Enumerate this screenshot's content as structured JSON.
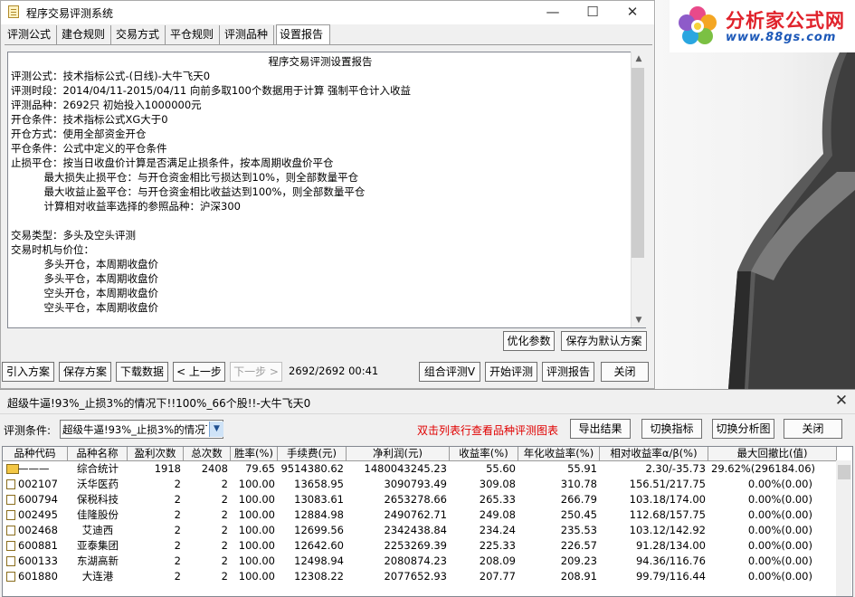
{
  "window": {
    "title": "程序交易评测系统",
    "minimize": "—",
    "maximize": "☐",
    "close": "✕"
  },
  "tabs": [
    "评测公式",
    "建仓规则",
    "交易方式",
    "平仓规则",
    "评测品种",
    "设置报告"
  ],
  "report": {
    "title": "程序交易评测设置报告",
    "lines": [
      "评测公式：技术指标公式-(日线)-大牛飞天0",
      "评测时段：2014/04/11-2015/04/11 向前多取100个数据用于计算 强制平仓计入收益",
      "评测品种：2692只 初始投入1000000元",
      "开仓条件：技术指标公式XG大于0",
      "开仓方式：使用全部资金开仓",
      "平仓条件：公式中定义的平仓条件",
      "止损平仓：按当日收盘价计算是否满足止损条件，按本周期收盘价平仓",
      "          最大损失止损平仓：与开仓资金相比亏损达到10%，则全部数量平仓",
      "          最大收益止盈平仓：与开仓资金相比收益达到100%，则全部数量平仓",
      "          计算相对收益率选择的参照品种：沪深300",
      "",
      "交易类型：多头及空头评测",
      "交易时机与价位：",
      "          多头开仓，本周期收盘价",
      "          多头平仓，本周期收盘价",
      "          空头开仓，本周期收盘价",
      "          空头平仓，本周期收盘价"
    ]
  },
  "buttons": {
    "optimize": "优化参数",
    "save_default": "保存为默认方案",
    "import_scheme": "引入方案",
    "save_scheme": "保存方案",
    "download_data": "下载数据",
    "prev_step": "< 上一步",
    "next_step": "下一步 >",
    "combo_eval": "组合评测V",
    "start_eval": "开始评测",
    "eval_report": "评测报告",
    "close": "关闭"
  },
  "progress": "2692/2692 00:41",
  "eval_window": {
    "title": "超级牛逼!93%_止损3%的情况下!!100%_66个股!!-大牛飞天0",
    "close": "✕",
    "criteria_label": "评测条件:",
    "criteria_value": "超级牛逼!93%_止损3%的情况下",
    "hint": "双击列表行查看品种评测图表",
    "buttons": {
      "export": "导出结果",
      "switch_indicator": "切换指标",
      "switch_chart": "切换分析图",
      "close": "关闭"
    }
  },
  "table": {
    "headers": [
      "品种代码",
      "品种名称",
      "盈利次数",
      "总次数",
      "胜率(%)",
      "手续费(元)",
      "净利润(元)",
      "收益率(%)",
      "年化收益率(%)",
      "相对收益率α/β(%)",
      "最大回撤比(值)"
    ],
    "rows": [
      [
        "———",
        "综合统计",
        "1918",
        "2408",
        "79.65",
        "9514380.62",
        "1480043245.23",
        "55.60",
        "55.91",
        "2.30/-35.73",
        "29.62%(296184.06)"
      ],
      [
        "002107",
        "沃华医药",
        "2",
        "2",
        "100.00",
        "13658.95",
        "3090793.49",
        "309.08",
        "310.78",
        "156.51/217.75",
        "0.00%(0.00)"
      ],
      [
        "600794",
        "保税科技",
        "2",
        "2",
        "100.00",
        "13083.61",
        "2653278.66",
        "265.33",
        "266.79",
        "103.18/174.00",
        "0.00%(0.00)"
      ],
      [
        "002495",
        "佳隆股份",
        "2",
        "2",
        "100.00",
        "12884.98",
        "2490762.71",
        "249.08",
        "250.45",
        "112.68/157.75",
        "0.00%(0.00)"
      ],
      [
        "002468",
        "艾迪西",
        "2",
        "2",
        "100.00",
        "12699.56",
        "2342438.84",
        "234.24",
        "235.53",
        "103.12/142.92",
        "0.00%(0.00)"
      ],
      [
        "600881",
        "亚泰集团",
        "2",
        "2",
        "100.00",
        "12642.60",
        "2253269.39",
        "225.33",
        "226.57",
        "91.28/134.00",
        "0.00%(0.00)"
      ],
      [
        "600133",
        "东湖高新",
        "2",
        "2",
        "100.00",
        "12498.94",
        "2080874.23",
        "208.09",
        "209.23",
        "94.36/116.76",
        "0.00%(0.00)"
      ],
      [
        "601880",
        "大连港",
        "2",
        "2",
        "100.00",
        "12308.22",
        "2077652.93",
        "207.77",
        "208.91",
        "99.79/116.44",
        "0.00%(0.00)"
      ]
    ]
  },
  "logo": {
    "name": "分析家公式网",
    "url": "www.88gs.com"
  },
  "colors": {
    "hint": "#e00000",
    "logo_red": "#e0222b",
    "logo_blue": "#1c58b8"
  }
}
